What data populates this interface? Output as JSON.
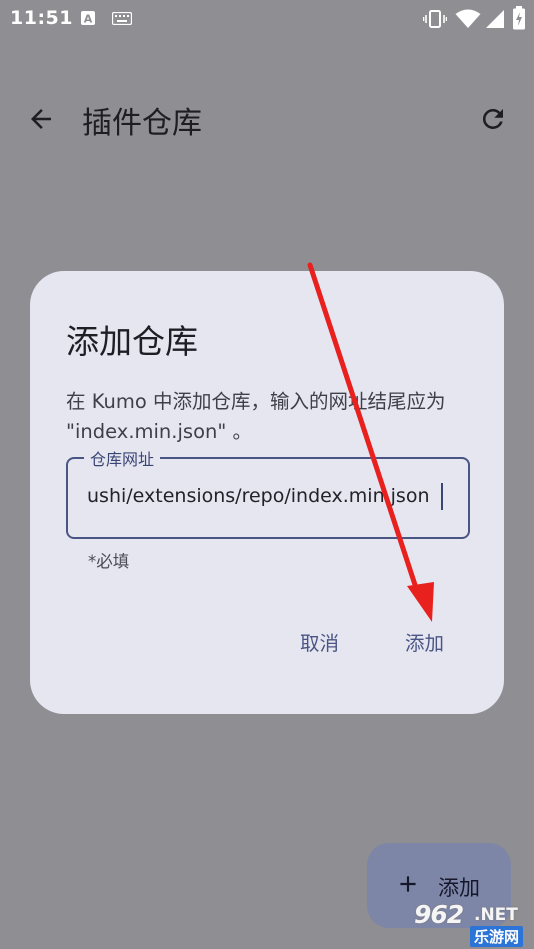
{
  "status_bar": {
    "time": "11:51"
  },
  "app_bar": {
    "title": "插件仓库"
  },
  "dialog": {
    "title": "添加仓库",
    "description": "在 Kumo 中添加仓库，输入的网址结尾应为 \"index.min.json\" 。",
    "field": {
      "label": "仓库网址",
      "value": "ushi/extensions/repo/index.min.json"
    },
    "helper_text": "*必填",
    "cancel_label": "取消",
    "confirm_label": "添加"
  },
  "fab": {
    "label": "添加"
  },
  "watermark": {
    "number": "962",
    "suffix": ".NET",
    "site_name": "乐游网"
  },
  "colors": {
    "scrim_background": "#8f8e92",
    "dialog_background": "#e6e6f1",
    "primary": "#4a5584",
    "annotation_arrow": "#e8201e"
  }
}
